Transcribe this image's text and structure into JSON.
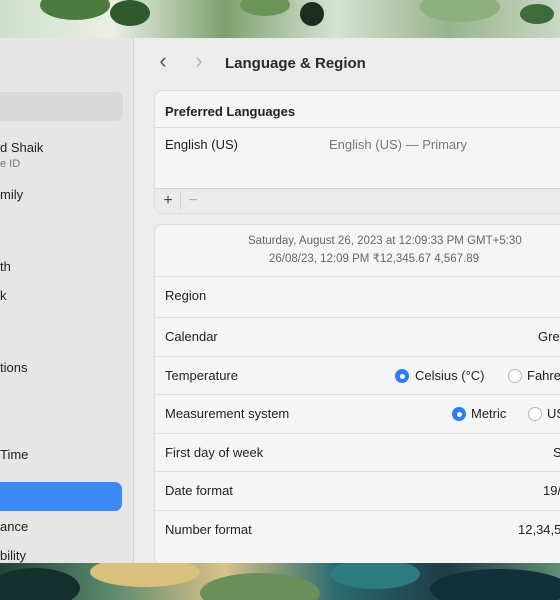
{
  "window": {
    "title": "Language & Region",
    "back_icon": "chevron-left-icon",
    "forward_icon": "chevron-right-icon"
  },
  "sidebar": {
    "account_name": "d Shaik",
    "account_sub": "e ID",
    "items": [
      {
        "label": "mily"
      },
      {
        "label": "th"
      },
      {
        "label": "k"
      },
      {
        "label": "tions"
      },
      {
        "label": "Time"
      },
      {
        "label": "ance"
      },
      {
        "label": "bility"
      }
    ]
  },
  "languages": {
    "header": "Preferred Languages",
    "items": [
      {
        "name": "English (US)",
        "detail": "English (US) — Primary"
      }
    ],
    "add_label": "+",
    "remove_label": "−"
  },
  "preview": {
    "line1": "Saturday, August 26, 2023 at 12:09:33 PM GMT+5:30",
    "line2": "26/08/23, 12:09 PM     ₹12,345.67     4,567.89"
  },
  "settings": {
    "region": {
      "label": "Region",
      "value": ""
    },
    "calendar": {
      "label": "Calendar",
      "value": "Gre"
    },
    "temperature": {
      "label": "Temperature",
      "options": [
        {
          "label": "Celsius (°C)",
          "selected": true
        },
        {
          "label": "Fahre",
          "selected": false
        }
      ]
    },
    "measurement": {
      "label": "Measurement system",
      "options": [
        {
          "label": "Metric",
          "selected": true
        },
        {
          "label": "US",
          "selected": false
        }
      ]
    },
    "first_day": {
      "label": "First day of week",
      "value": "S"
    },
    "date_format": {
      "label": "Date format",
      "value": "19/"
    },
    "number_format": {
      "label": "Number format",
      "value": "12,34,5"
    }
  },
  "colors": {
    "accent": "#2f7cf6",
    "sidebar_selected": "#3d8af7"
  }
}
